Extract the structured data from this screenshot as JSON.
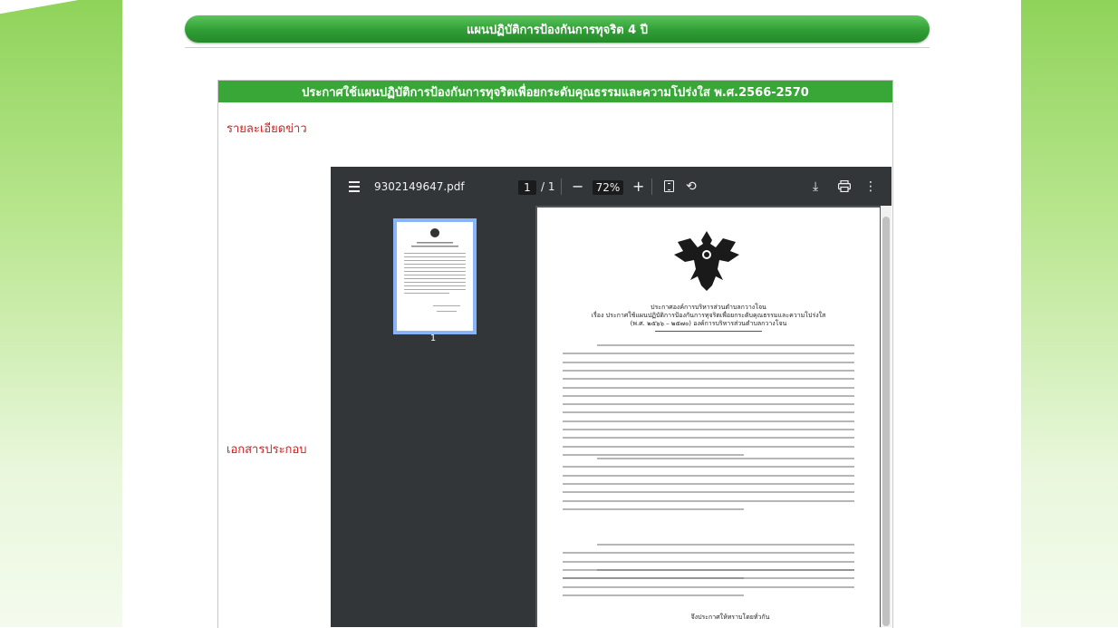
{
  "banner": {
    "title": "แผนปฏิบัติการป้องกันการทุจริต 4 ปี"
  },
  "panel": {
    "header": "ประกาศใช้แผนปฏิบัติการป้องกันการทุจริตเพื่อยกระดับคุณธรรมและความโปร่งใส พ.ศ.2566-2570",
    "details_label": "รายละเอียดข่าว",
    "attachments_label": "เอกสารประกอบ"
  },
  "viewer": {
    "filename": "9302149647.pdf",
    "page_current": "1",
    "page_total": "/ 1",
    "zoom": "72%",
    "thumbnail_label": "1"
  },
  "document": {
    "org": "ประกาศองค์การบริหารส่วนตำบลกวางโจน",
    "subject": "เรื่อง  ประกาศใช้แผนปฏิบัติการป้องกันการทุจริตเพื่อยกระดับคุณธรรมและความโปร่งใส",
    "period": "(พ.ศ. ๒๕๖๖ – ๒๕๗๐) องค์การบริหารส่วนตำบลกวางโจน",
    "closing": "จึงประกาศให้ทราบโดยทั่วกัน"
  },
  "colors": {
    "banner_green": "#2f9e34",
    "header_green": "#38a738",
    "label_red": "#d81f1f",
    "side_green": "#8fd35a",
    "viewer_toolbar": "#323639"
  },
  "icons": [
    "menu-icon",
    "fit-page-icon",
    "rotate-icon",
    "download-icon",
    "print-icon",
    "more-vert-icon"
  ]
}
